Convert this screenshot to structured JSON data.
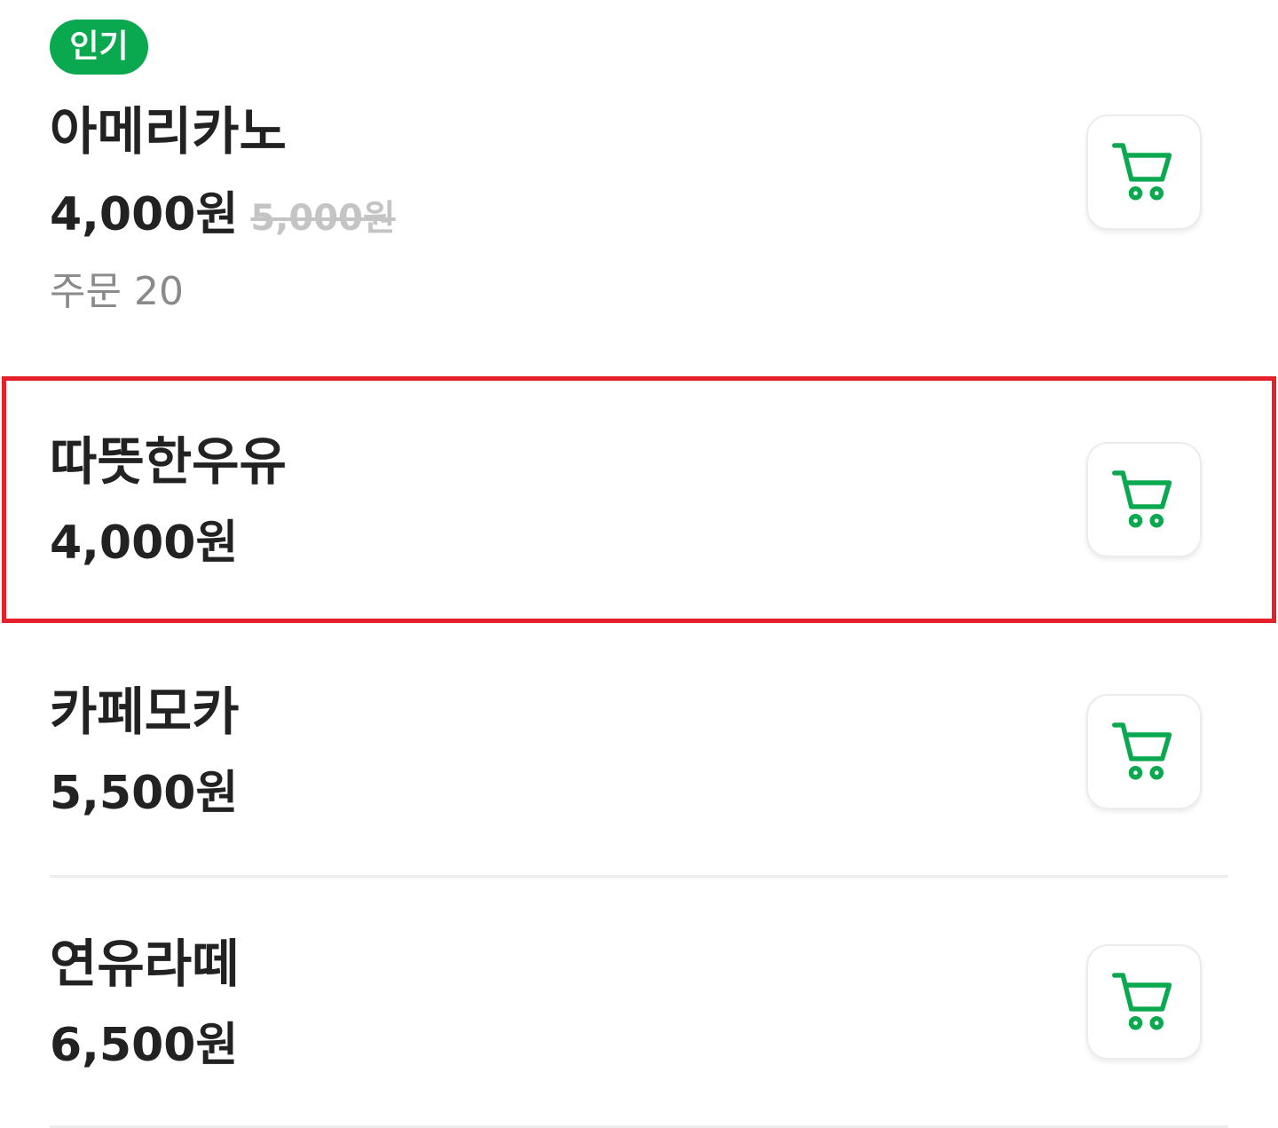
{
  "accent_color": "#0aa84f",
  "highlight_color": "#e4212b",
  "items": [
    {
      "badge": "인기",
      "name": "아메리카노",
      "price": "4,000원",
      "original_price": "5,000원",
      "orders": "주문 20",
      "cart_icon": "cart-icon"
    },
    {
      "name": "따뜻한우유",
      "price": "4,000원",
      "cart_icon": "cart-icon"
    },
    {
      "name": "카페모카",
      "price": "5,500원",
      "cart_icon": "cart-icon"
    },
    {
      "name": "연유라떼",
      "price": "6,500원",
      "cart_icon": "cart-icon"
    }
  ]
}
